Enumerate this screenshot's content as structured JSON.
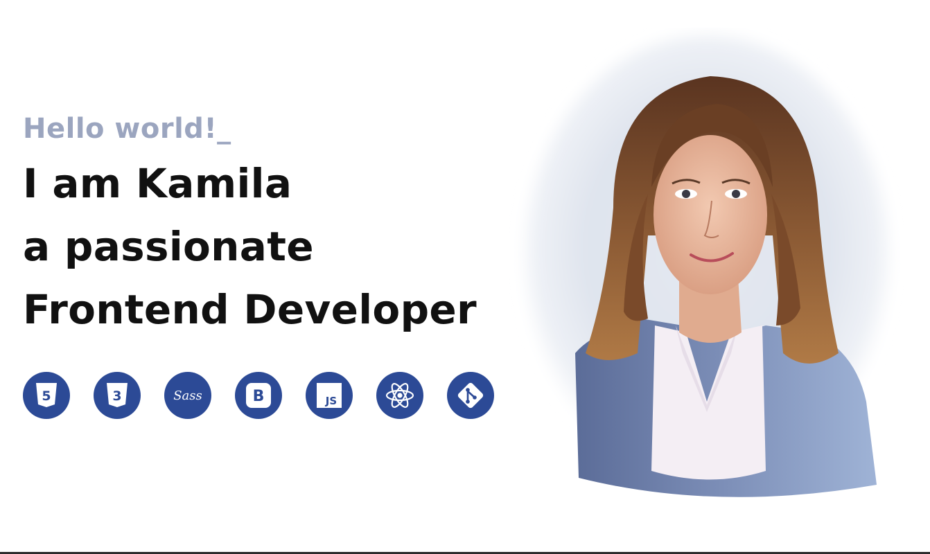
{
  "hero": {
    "greeting": "Hello world!_",
    "headline_lines": [
      "I am Kamila",
      "a passionate",
      "Frontend Developer"
    ]
  },
  "skills": [
    {
      "name": "HTML5",
      "icon": "html5-icon"
    },
    {
      "name": "CSS3",
      "icon": "css3-icon"
    },
    {
      "name": "Sass",
      "icon": "sass-icon"
    },
    {
      "name": "Bootstrap",
      "icon": "bootstrap-icon"
    },
    {
      "name": "JavaScript",
      "icon": "javascript-icon"
    },
    {
      "name": "React",
      "icon": "react-icon"
    },
    {
      "name": "Git",
      "icon": "git-icon"
    }
  ],
  "icon_text": {
    "html": "5",
    "css": "3",
    "sass": "Sass",
    "bootstrap": "B",
    "js": "JS"
  },
  "colors": {
    "greeting": "#9ba5bf",
    "headline": "#111111",
    "icon_bg": "#2c4a96",
    "icon_fg": "#ffffff"
  }
}
